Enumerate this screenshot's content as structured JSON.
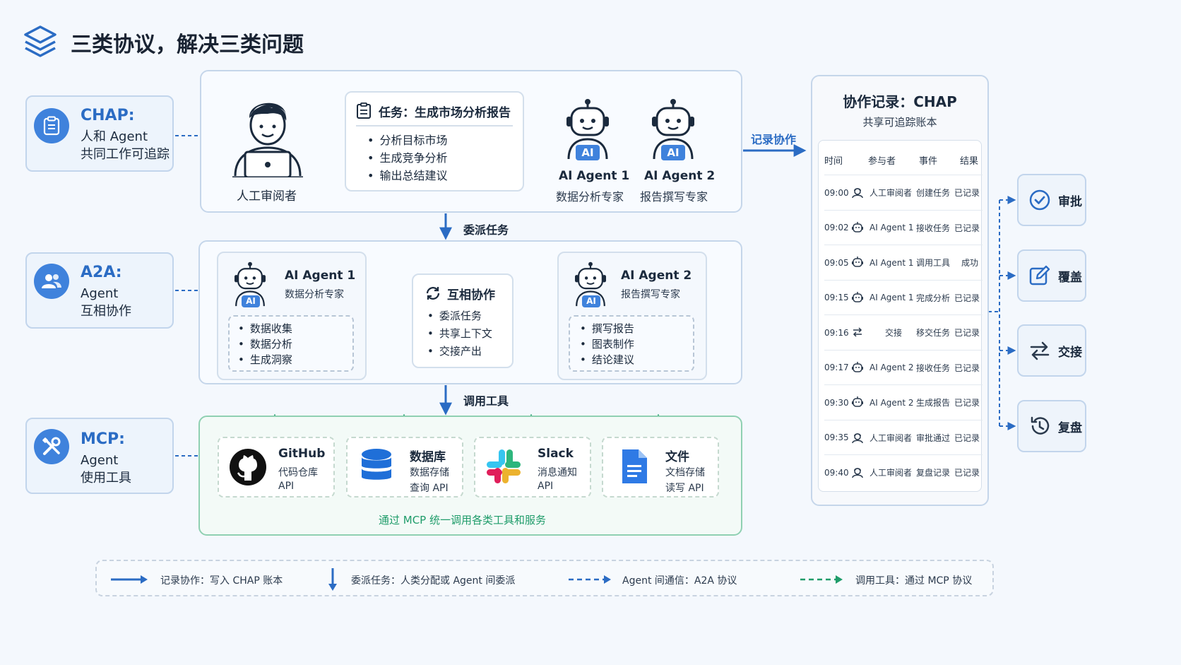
{
  "title": "三类协议，解决三类问题",
  "protocols": [
    {
      "name": "CHAP:",
      "line1": "人和 Agent",
      "line2": "共同工作可追踪"
    },
    {
      "name": "A2A:",
      "line1": "Agent",
      "line2": "互相协作"
    },
    {
      "name": "MCP:",
      "line1": "Agent",
      "line2": "使用工具"
    }
  ],
  "chap_panel": {
    "human_label": "人工审阅者",
    "task_title": "任务：生成市场分析报告",
    "task_items": [
      "分析目标市场",
      "生成竞争分析",
      "输出总结建议"
    ],
    "agents": [
      {
        "badge": "AI",
        "name": "AI Agent 1",
        "role": "数据分析专家"
      },
      {
        "badge": "AI",
        "name": "AI Agent 2",
        "role": "报告撰写专家"
      }
    ]
  },
  "arrow_labels": {
    "delegate": "委派任务",
    "call_tools": "调用工具",
    "record": "记录协作"
  },
  "a2a_panel": {
    "agent1": {
      "badge": "AI",
      "name": "AI Agent 1",
      "role": "数据分析专家",
      "items": [
        "数据收集",
        "数据分析",
        "生成洞察"
      ]
    },
    "collab": {
      "title": "互相协作",
      "items": [
        "委派任务",
        "共享上下文",
        "交接产出"
      ]
    },
    "agent2": {
      "badge": "AI",
      "name": "AI Agent 2",
      "role": "报告撰写专家",
      "items": [
        "撰写报告",
        "图表制作",
        "结论建议"
      ]
    }
  },
  "mcp_panel": {
    "tools": [
      {
        "icon": "github-icon",
        "name": "GitHub",
        "line1": "代码仓库",
        "line2": "API"
      },
      {
        "icon": "database-icon",
        "name": "数据库",
        "line1": "数据存储",
        "line2": "查询 API"
      },
      {
        "icon": "slack-icon",
        "name": "Slack",
        "line1": "消息通知",
        "line2": "API"
      },
      {
        "icon": "document-icon",
        "name": "文件",
        "line1": "文档存储",
        "line2": "读写 API"
      }
    ],
    "footer": "通过 MCP 统一调用各类工具和服务"
  },
  "ledger": {
    "title": "协作记录：CHAP",
    "subtitle": "共享可追踪账本",
    "headers": [
      "时间",
      "参与者",
      "事件",
      "结果"
    ],
    "rows": [
      {
        "time": "09:00",
        "icon": "human",
        "actor": "人工审阅者",
        "event": "创建任务",
        "result": "已记录"
      },
      {
        "time": "09:02",
        "icon": "robot",
        "actor": "AI Agent 1",
        "event": "接收任务",
        "result": "已记录"
      },
      {
        "time": "09:05",
        "icon": "robot",
        "actor": "AI Agent 1",
        "event": "调用工具",
        "result": "成功"
      },
      {
        "time": "09:15",
        "icon": "robot",
        "actor": "AI Agent 1",
        "event": "完成分析",
        "result": "已记录"
      },
      {
        "time": "09:16",
        "icon": "swap",
        "actor": "交接",
        "event": "移交任务",
        "result": "已记录"
      },
      {
        "time": "09:17",
        "icon": "robot",
        "actor": "AI Agent 2",
        "event": "接收任务",
        "result": "已记录"
      },
      {
        "time": "09:30",
        "icon": "robot",
        "actor": "AI Agent 2",
        "event": "生成报告",
        "result": "已记录"
      },
      {
        "time": "09:35",
        "icon": "human",
        "actor": "人工审阅者",
        "event": "审批通过",
        "result": "已记录"
      },
      {
        "time": "09:40",
        "icon": "human",
        "actor": "人工审阅者",
        "event": "复盘记录",
        "result": "已记录"
      }
    ]
  },
  "actions": [
    {
      "icon": "check-circle-icon",
      "label": "审批"
    },
    {
      "icon": "edit-icon",
      "label": "覆盖"
    },
    {
      "icon": "swap-icon",
      "label": "交接"
    },
    {
      "icon": "history-icon",
      "label": "复盘"
    }
  ],
  "legend": [
    {
      "style": "solid-blue",
      "text": "记录协作：写入 CHAP 账本"
    },
    {
      "style": "down-blue",
      "text": "委派任务：人类分配或 Agent 间委派"
    },
    {
      "style": "dashed-blue",
      "text": "Agent 间通信：A2A 协议"
    },
    {
      "style": "dashed-green",
      "text": "调用工具：通过 MCP 协议"
    }
  ],
  "colors": {
    "accent": "#2b6cc4",
    "green": "#1f9c6a",
    "panel_border": "#c5d6ea"
  }
}
